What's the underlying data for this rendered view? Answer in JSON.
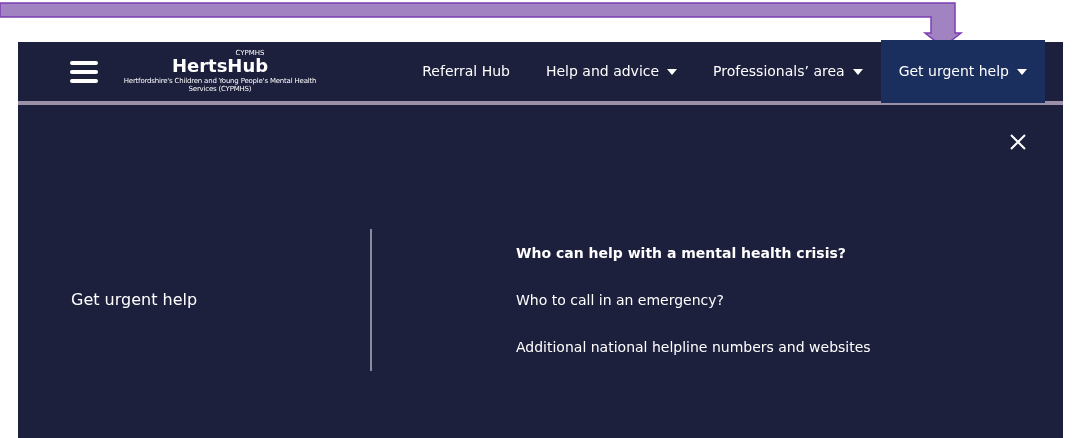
{
  "logo": {
    "overline": "CYPMHS",
    "name": "HertsHub",
    "tagline": "Hertfordshire's Children and Young People's Mental Health Services (CYPMHS)"
  },
  "nav": [
    {
      "label": "Referral Hub",
      "dropdown": false,
      "selected": false
    },
    {
      "label": "Help and advice",
      "dropdown": true,
      "selected": false
    },
    {
      "label": "Professionals’ area",
      "dropdown": true,
      "selected": false
    },
    {
      "label": "Get urgent help",
      "dropdown": true,
      "selected": true
    }
  ],
  "menu": {
    "title": "Get urgent help",
    "links": [
      {
        "label": "Who can help with a mental health crisis?",
        "selected": true
      },
      {
        "label": "Who to call in an emergency?",
        "selected": false
      },
      {
        "label": "Additional national helpline numbers and websites",
        "selected": false
      }
    ]
  }
}
